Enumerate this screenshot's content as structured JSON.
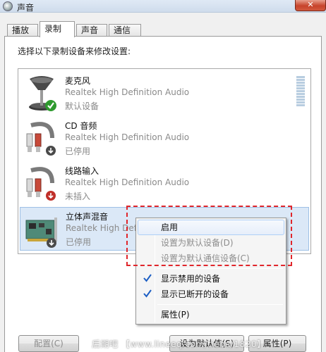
{
  "window": {
    "title": "声音",
    "close_glyph": "✕"
  },
  "tabs": [
    {
      "label": "播放"
    },
    {
      "label": "录制"
    },
    {
      "label": "声音"
    },
    {
      "label": "通信"
    }
  ],
  "instruction": "选择以下录制设备来修改设置:",
  "devices": [
    {
      "name": "麦克风",
      "driver": "Realtek High Definition Audio",
      "status": "默认设备",
      "icon": "microphone-icon",
      "badge": "default-check-badge"
    },
    {
      "name": "CD 音频",
      "driver": "Realtek High Definition Audio",
      "status": "已停用",
      "icon": "audio-cable-icon",
      "badge": "disabled-badge"
    },
    {
      "name": "线路输入",
      "driver": "Realtek High Definition Audio",
      "status": "未插入",
      "icon": "audio-cable-icon",
      "badge": "unplugged-badge"
    },
    {
      "name": "立体声混音",
      "driver": "Realtek High Defi",
      "status": "已停用",
      "icon": "sound-card-icon",
      "badge": "disabled-badge"
    }
  ],
  "context_menu": {
    "items": [
      {
        "label": "启用",
        "state": "highlighted"
      },
      {
        "label": "设置为默认设备(D)",
        "state": "disabled"
      },
      {
        "label": "设置为默认通信设备(C)",
        "state": "disabled"
      }
    ],
    "checked_items": [
      {
        "label": "显示禁用的设备",
        "checked": true
      },
      {
        "label": "显示已断开的设备",
        "checked": true
      }
    ],
    "properties": {
      "label": "属性(P)"
    }
  },
  "buttons": {
    "configure": "配置(C)",
    "set_default": "设为默认值(S)",
    "properties": "属性(P)"
  },
  "watermark": "后期吧 【www.lineeq.com/tieba/1820】",
  "colors": {
    "selection": "#dbe8f7",
    "annotation": "#e0262b",
    "check": "#1d5fc4"
  }
}
